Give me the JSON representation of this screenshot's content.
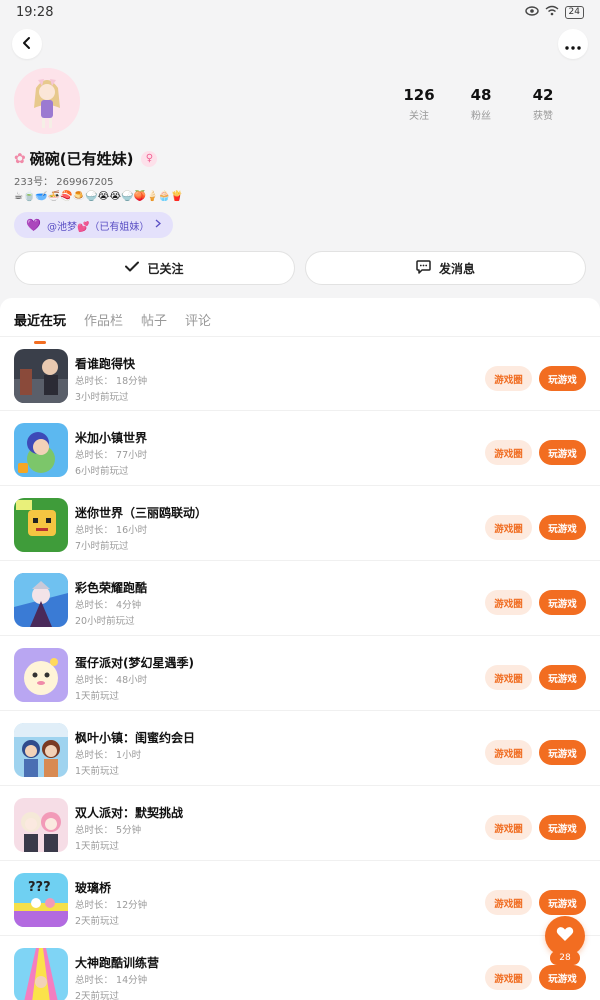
{
  "status_bar": {
    "time": "19:28",
    "battery": "24"
  },
  "profile": {
    "stats": [
      {
        "value": "126",
        "label": "关注"
      },
      {
        "value": "48",
        "label": "粉丝"
      },
      {
        "value": "42",
        "label": "获赞"
      }
    ],
    "nickname": "碗碗(已有姓妹)",
    "uid": "233号： 269967205",
    "emoji_signature": "☕🍵🥣🍜🍣🍮🍚😭😭🍚🍑🍦🧁🍟",
    "cp_tag": "@池梦💕（已有姐妹）",
    "follow_label": "已关注",
    "message_label": "发消息"
  },
  "tabs": [
    "最近在玩",
    "作品栏",
    "帖子",
    "评论"
  ],
  "buttons": {
    "circle": "游戏圈",
    "play": "玩游戏"
  },
  "games": [
    {
      "name": "看谁跑得快",
      "duration": "总时长： 18分钟",
      "last_played": "3小时前玩过"
    },
    {
      "name": "米加小镇世界",
      "duration": "总时长： 77小时",
      "last_played": "6小时前玩过"
    },
    {
      "name": "迷你世界（三丽鸥联动）",
      "duration": "总时长： 16小时",
      "last_played": "7小时前玩过"
    },
    {
      "name": "彩色荣耀跑酷",
      "duration": "总时长： 4分钟",
      "last_played": "20小时前玩过"
    },
    {
      "name": "蛋仔派对(梦幻星遇季)",
      "duration": "总时长： 48小时",
      "last_played": "1天前玩过"
    },
    {
      "name": "枫叶小镇：闺蜜约会日",
      "duration": "总时长： 1小时",
      "last_played": "1天前玩过"
    },
    {
      "name": "双人派对：默契挑战",
      "duration": "总时长： 5分钟",
      "last_played": "1天前玩过"
    },
    {
      "name": "玻璃桥",
      "duration": "总时长： 12分钟",
      "last_played": "2天前玩过"
    },
    {
      "name": "大神跑酷训练营",
      "duration": "总时长： 14分钟",
      "last_played": "2天前玩过"
    }
  ],
  "fab": {
    "count": "28"
  },
  "colors": {
    "accent": "#f26d21",
    "accent_light": "#fdeadf",
    "cp_bg": "#e4e1fb"
  }
}
